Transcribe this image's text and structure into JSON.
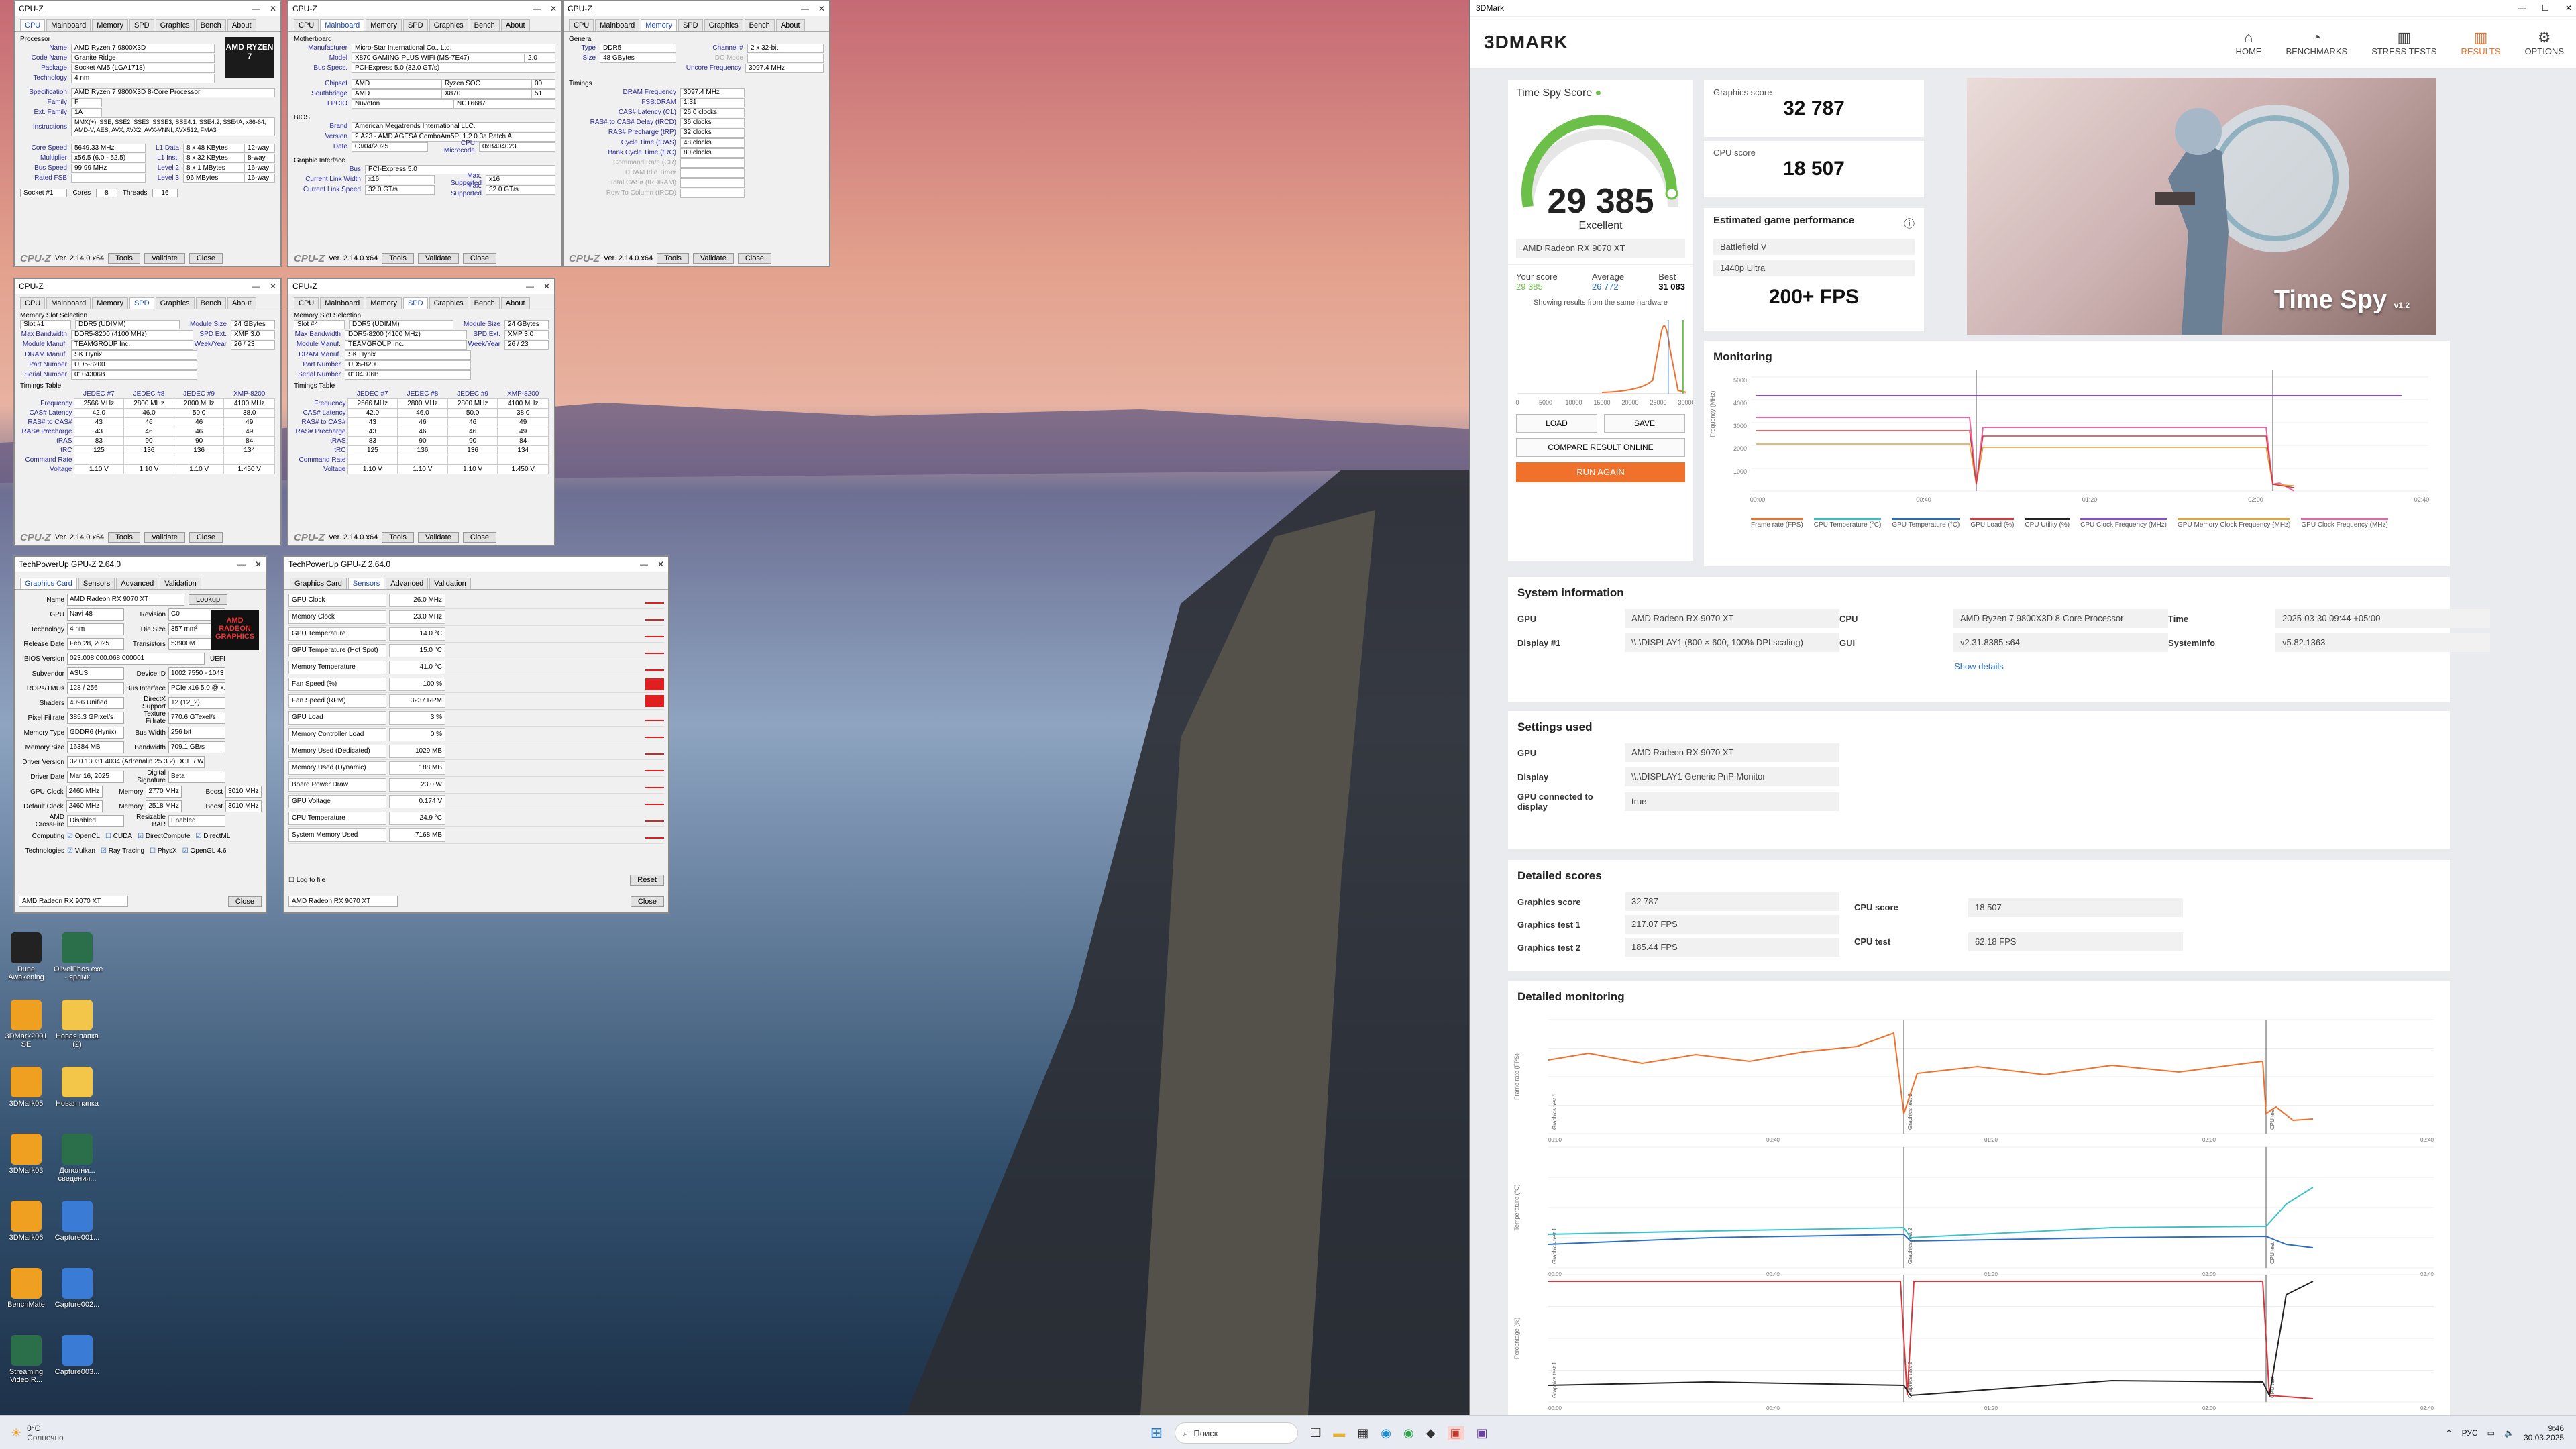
{
  "cpuz1": {
    "title": "CPU-Z",
    "tabs": [
      "CPU",
      "Mainboard",
      "Memory",
      "SPD",
      "Graphics",
      "Bench",
      "About"
    ],
    "proc_label": "Processor",
    "fields": [
      [
        "Name",
        "AMD Ryzen 7 9800X3D"
      ],
      [
        "Code Name",
        "Granite Ridge"
      ],
      [
        "Package",
        "Socket AM5 (LGA1718)"
      ],
      [
        "Technology",
        "4 nm"
      ],
      [
        "Specification",
        "AMD Ryzen 7 9800X3D 8-Core Processor"
      ],
      [
        "Family",
        "F"
      ],
      [
        "Ext. Family",
        "1A"
      ],
      [
        "Instructions",
        "MMX(+), SSE, SSE2, SSE3, SSSE3, SSE4.1, SSE4.2, SSE4A, x86-64, AMD-V, AES, AVX, AVX2, AVX-VNNI, AVX512, FMA3"
      ]
    ],
    "clocks": [
      [
        "Core Speed",
        "5649.33 MHz"
      ],
      [
        "Multiplier",
        "x56.5 (6.0 - 52.5)"
      ],
      [
        "Bus Speed",
        "99.99 MHz"
      ],
      [
        "Rated FSB",
        ""
      ]
    ],
    "cache": [
      [
        "L1 Data",
        "8 x 48 KBytes",
        "12-way"
      ],
      [
        "L1 Inst.",
        "8 x 32 KBytes",
        "8-way"
      ],
      [
        "Level 2",
        "8 x 1 MBytes",
        "16-way"
      ],
      [
        "Level 3",
        "96 MBytes",
        "16-way"
      ]
    ],
    "selection": "Socket #1",
    "cores": "8",
    "threads": "16",
    "logo": "AMD RYZEN 7",
    "version": "Ver. 2.14.0.x64",
    "tools": "Tools",
    "validate": "Validate",
    "close": "Close"
  },
  "cpuz2": {
    "title": "CPU-Z",
    "section": "Motherboard",
    "fields": [
      [
        "Manufacturer",
        "Micro-Star International Co., Ltd."
      ],
      [
        "Model",
        "X870 GAMING PLUS WIFI (MS-7E47)",
        "2.0"
      ],
      [
        "Bus Specs.",
        "PCI-Express 5.0 (32.0 GT/s)"
      ],
      [
        "Chipset",
        "AMD",
        "Ryzen SOC",
        "00"
      ],
      [
        "Southbridge",
        "AMD",
        "X870",
        "51"
      ],
      [
        "LPCIO",
        "Nuvoton",
        "NCT6687"
      ]
    ],
    "bios_label": "BIOS",
    "bios": [
      [
        "Brand",
        "American Megatrends International LLC."
      ],
      [
        "Version",
        "2.A23 - AMD AGESA ComboAm5PI 1.2.0.3a Patch A"
      ],
      [
        "Date",
        "03/04/2025",
        "CPU Microcode",
        "0xB404023"
      ]
    ],
    "gi_label": "Graphic Interface",
    "gi": [
      [
        "Bus",
        "PCI-Express 5.0"
      ],
      [
        "Current Link Width",
        "x16",
        "Max. Supported",
        "x16"
      ],
      [
        "Current Link Speed",
        "32.0 GT/s",
        "Max. Supported",
        "32.0 GT/s"
      ]
    ],
    "version": "Ver. 2.14.0.x64"
  },
  "cpuz3": {
    "title": "CPU-Z",
    "general_label": "General",
    "general": [
      [
        "Type",
        "DDR5",
        "Channel #",
        "2 x 32-bit"
      ],
      [
        "Size",
        "48 GBytes",
        "DC Mode",
        ""
      ],
      [
        "",
        "",
        "Uncore Frequency",
        "3097.4 MHz"
      ]
    ],
    "timings_label": "Timings",
    "timings": [
      [
        "DRAM Frequency",
        "3097.4 MHz"
      ],
      [
        "FSB:DRAM",
        "1:31"
      ],
      [
        "CAS# Latency (CL)",
        "26.0 clocks"
      ],
      [
        "RAS# to CAS# Delay (tRCD)",
        "36 clocks"
      ],
      [
        "RAS# Precharge (tRP)",
        "32 clocks"
      ],
      [
        "Cycle Time (tRAS)",
        "48 clocks"
      ],
      [
        "Bank Cycle Time (tRC)",
        "80 clocks"
      ],
      [
        "Command Rate (CR)",
        ""
      ],
      [
        "DRAM Idle Timer",
        ""
      ],
      [
        "Total CAS# (tRDRAM)",
        ""
      ],
      [
        "Row To Column (tRCD)",
        ""
      ]
    ],
    "version": "Ver. 2.14.0.x64"
  },
  "spd1": {
    "title": "CPU-Z",
    "slot_label": "Memory Slot Selection",
    "slot": "Slot #1",
    "type": "DDR5 (UDIMM)",
    "module_size": "24 GBytes",
    "max_bw": "DDR5-8200 (4100 MHz)",
    "spd_ext": "XMP 3.0",
    "manuf": "TEAMGROUP Inc.",
    "week": "26 / 23",
    "dram_manuf": "SK Hynix",
    "part": "UD5-8200",
    "serial": "0104306B",
    "tt_label": "Timings Table",
    "tt_head": [
      "JEDEC #7",
      "JEDEC #8",
      "JEDEC #9",
      "XMP-8200"
    ],
    "tt": [
      [
        "Frequency",
        "2566 MHz",
        "2800 MHz",
        "2800 MHz",
        "4100 MHz"
      ],
      [
        "CAS# Latency",
        "42.0",
        "46.0",
        "50.0",
        "38.0"
      ],
      [
        "RAS# to CAS#",
        "43",
        "46",
        "46",
        "49"
      ],
      [
        "RAS# Precharge",
        "43",
        "46",
        "46",
        "49"
      ],
      [
        "tRAS",
        "83",
        "90",
        "90",
        "84"
      ],
      [
        "tRC",
        "125",
        "136",
        "136",
        "134"
      ],
      [
        "Command Rate",
        "",
        "",
        "",
        ""
      ],
      [
        "Voltage",
        "1.10 V",
        "1.10 V",
        "1.10 V",
        "1.450 V"
      ]
    ],
    "version": "Ver. 2.14.0.x64"
  },
  "spd2": {
    "title": "CPU-Z",
    "slot": "Slot #4",
    "type": "DDR5 (UDIMM)",
    "module_size": "24 GBytes",
    "max_bw": "DDR5-8200 (4100 MHz)",
    "spd_ext": "XMP 3.0",
    "manuf": "TEAMGROUP Inc.",
    "week": "26 / 23",
    "dram_manuf": "SK Hynix",
    "part": "UD5-8200",
    "serial": "0104306B"
  },
  "gpuz1": {
    "title": "TechPowerUp GPU-Z 2.64.0",
    "tabs": [
      "Graphics Card",
      "Sensors",
      "Advanced",
      "Validation"
    ],
    "rows": [
      [
        "Name",
        "AMD Radeon RX 9070 XT"
      ],
      [
        "GPU",
        "Navi 48",
        "Revision",
        "C0"
      ],
      [
        "Technology",
        "4 nm",
        "Die Size",
        "357 mm²"
      ],
      [
        "Release Date",
        "Feb 28, 2025",
        "Transistors",
        "53900M"
      ],
      [
        "BIOS Version",
        "023.008.000.068.000001"
      ],
      [
        "Subvendor",
        "ASUS",
        "Device ID",
        "1002 7550 - 1043 061A"
      ],
      [
        "ROPs/TMUs",
        "128 / 256",
        "Bus Interface",
        "PCIe x16 5.0 @ x16 5.0"
      ],
      [
        "Shaders",
        "4096 Unified",
        "DirectX Support",
        "12 (12_2)"
      ],
      [
        "Pixel Fillrate",
        "385.3 GPixel/s",
        "Texture Fillrate",
        "770.6 GTexel/s"
      ],
      [
        "Memory Type",
        "GDDR6 (Hynix)",
        "Bus Width",
        "256 bit"
      ],
      [
        "Memory Size",
        "16384 MB",
        "Bandwidth",
        "709.1 GB/s"
      ],
      [
        "Driver Version",
        "32.0.13031.4034 (Adrenalin 25.3.2) DCH / Win11 64"
      ],
      [
        "Driver Date",
        "Mar 16, 2025",
        "Digital Signature",
        "Beta"
      ],
      [
        "GPU Clock",
        "2460 MHz",
        "Memory",
        "2770 MHz",
        "Boost",
        "3010 MHz"
      ],
      [
        "Default Clock",
        "2460 MHz",
        "Memory",
        "2518 MHz",
        "Boost",
        "3010 MHz"
      ],
      [
        "AMD CrossFire",
        "Disabled",
        "Resizable BAR",
        "Enabled"
      ]
    ],
    "computing_label": "Computing",
    "computing": [
      "OpenCL",
      "CUDA",
      "DirectCompute",
      "DirectML"
    ],
    "tech_label": "Technologies",
    "tech": [
      "Vulkan",
      "Ray Tracing",
      "PhysX",
      "OpenGL 4.6"
    ],
    "lookup": "Lookup",
    "uefi": "UEFI",
    "dropdown": "AMD Radeon RX 9070 XT",
    "close": "Close",
    "logo": "AMD RADEON GRAPHICS"
  },
  "gpuz2": {
    "title": "TechPowerUp GPU-Z 2.64.0",
    "sensors": [
      [
        "GPU Clock",
        "26.0 MHz"
      ],
      [
        "Memory Clock",
        "23.0 MHz"
      ],
      [
        "GPU Temperature",
        "14.0 °C"
      ],
      [
        "GPU Temperature (Hot Spot)",
        "15.0 °C"
      ],
      [
        "Memory Temperature",
        "41.0 °C"
      ],
      [
        "Fan Speed (%)",
        "100 %"
      ],
      [
        "Fan Speed (RPM)",
        "3237 RPM"
      ],
      [
        "GPU Load",
        "3 %"
      ],
      [
        "Memory Controller Load",
        "0 %"
      ],
      [
        "Memory Used (Dedicated)",
        "1029 MB"
      ],
      [
        "Memory Used (Dynamic)",
        "188 MB"
      ],
      [
        "Board Power Draw",
        "23.0 W"
      ],
      [
        "GPU Voltage",
        "0.174 V"
      ],
      [
        "CPU Temperature",
        "24.9 °C"
      ],
      [
        "System Memory Used",
        "7168 MB"
      ]
    ],
    "log": "Log to file",
    "reset": "Reset",
    "dropdown": "AMD Radeon RX 9070 XT",
    "close": "Close"
  },
  "desktop_icons": [
    {
      "label": "Dune Awakening",
      "icon": "game-icon"
    },
    {
      "label": "OliveiPhos.exe - ярлык",
      "icon": "app-icon"
    },
    {
      "label": "3DMark2001 SE",
      "icon": "benchmark-icon"
    },
    {
      "label": "Новая папка (2)",
      "icon": "folder-icon"
    },
    {
      "label": "3DMark05",
      "icon": "benchmark-icon"
    },
    {
      "label": "Новая папка",
      "icon": "folder-icon"
    },
    {
      "label": "3DMark03",
      "icon": "benchmark-icon"
    },
    {
      "label": "Дополни... сведения...",
      "icon": "app-icon"
    },
    {
      "label": "3DMark06",
      "icon": "benchmark-icon"
    },
    {
      "label": "Capture001...",
      "icon": "image-icon"
    },
    {
      "label": "BenchMate",
      "icon": "benchmark-icon"
    },
    {
      "label": "Capture002...",
      "icon": "image-icon"
    },
    {
      "label": "Streaming Video R...",
      "icon": "app-icon"
    },
    {
      "label": "Capture003...",
      "icon": "image-icon"
    }
  ],
  "tdmark": {
    "window_title": "3DMark",
    "logo": "3DMARK",
    "nav": [
      {
        "label": "HOME",
        "icon": "⌂"
      },
      {
        "label": "BENCHMARKS",
        "icon": "◔"
      },
      {
        "label": "STRESS TESTS",
        "icon": "▥"
      },
      {
        "label": "RESULTS",
        "icon": "▥"
      },
      {
        "label": "OPTIONS",
        "icon": "⚙"
      }
    ],
    "score_title": "Time Spy Score",
    "score": "29 385",
    "rating": "Excellent",
    "gpu": "AMD Radeon RX 9070 XT",
    "your_score_label": "Your score",
    "your_score": "29 385",
    "average_label": "Average",
    "average": "26 772",
    "best_label": "Best",
    "best": "31 083",
    "hw_note": "Showing results from the same hardware",
    "dist_ticks": [
      "0",
      "5000",
      "10000",
      "15000",
      "20000",
      "25000",
      "30000"
    ],
    "load": "LOAD",
    "save": "SAVE",
    "compare": "COMPARE RESULT ONLINE",
    "run": "RUN AGAIN",
    "graphics_score_label": "Graphics score",
    "graphics_score": "32 787",
    "cpu_score_label": "CPU score",
    "cpu_score": "18 507",
    "egp_label": "Estimated game performance",
    "game": "Battlefield V",
    "preset": "1440p Ultra",
    "fps": "200+ FPS",
    "hero_title": "Time Spy",
    "hero_version": "v1.2",
    "monitoring_label": "Monitoring",
    "mon_y": "Frequency (MHz)",
    "mon_legend": [
      {
        "label": "Frame rate (FPS)",
        "color": "#f0712b"
      },
      {
        "label": "CPU Temperature (°C)",
        "color": "#39c1c9"
      },
      {
        "label": "GPU Temperature (°C)",
        "color": "#2c6fbe"
      },
      {
        "label": "GPU Load (%)",
        "color": "#d8383c"
      },
      {
        "label": "CPU Utility (%)",
        "color": "#222222"
      },
      {
        "label": "CPU Clock Frequency (MHz)",
        "color": "#8a4fd0"
      },
      {
        "label": "GPU Memory Clock Frequency (MHz)",
        "color": "#e0a43a"
      },
      {
        "label": "GPU Clock Frequency (MHz)",
        "color": "#e66aa4"
      }
    ],
    "time_ticks": [
      "00:00",
      "00:40",
      "01:20",
      "02:00",
      "02:40"
    ],
    "sysinfo_label": "System information",
    "sysinfo": [
      {
        "k": "GPU",
        "v": "AMD Radeon RX 9070 XT"
      },
      {
        "k": "CPU",
        "v": "AMD Ryzen 7 9800X3D 8-Core Processor"
      },
      {
        "k": "Time",
        "v": "2025-03-30 09:44 +05:00"
      },
      {
        "k": "Display #1",
        "v": "\\\\.\\DISPLAY1 (800 × 600, 100% DPI scaling)"
      },
      {
        "k": "GUI",
        "v": "v2.31.8385 s64"
      },
      {
        "k": "SystemInfo",
        "v": "v5.82.1363"
      }
    ],
    "show_details": "Show details",
    "settings_label": "Settings used",
    "settings": [
      {
        "k": "GPU",
        "v": "AMD Radeon RX 9070 XT"
      },
      {
        "k": "Display",
        "v": "\\\\.\\DISPLAY1 Generic PnP Monitor"
      },
      {
        "k": "GPU connected to display",
        "v": "true"
      }
    ],
    "detailed_label": "Detailed scores",
    "detailed_left": [
      {
        "k": "Graphics score",
        "v": "32 787"
      },
      {
        "k": "Graphics test 1",
        "v": "217.07 FPS"
      },
      {
        "k": "Graphics test 2",
        "v": "185.44 FPS"
      }
    ],
    "detailed_right": [
      {
        "k": "CPU score",
        "v": "18 507"
      },
      {
        "k": "CPU test",
        "v": "62.18 FPS"
      }
    ],
    "dmon_label": "Detailed monitoring",
    "dmon_y": [
      "Frame rate (FPS)",
      "Temperature (°C)",
      "Percentage (%)"
    ],
    "section_labels": [
      "Graphics test 1",
      "Graphics test 2",
      "CPU test"
    ]
  },
  "taskbar": {
    "search": "Поиск",
    "lang": "РУС",
    "time": "9:46",
    "date": "30.03.2025",
    "weather_temp": "0°C",
    "weather_desc": "Солнечно"
  }
}
